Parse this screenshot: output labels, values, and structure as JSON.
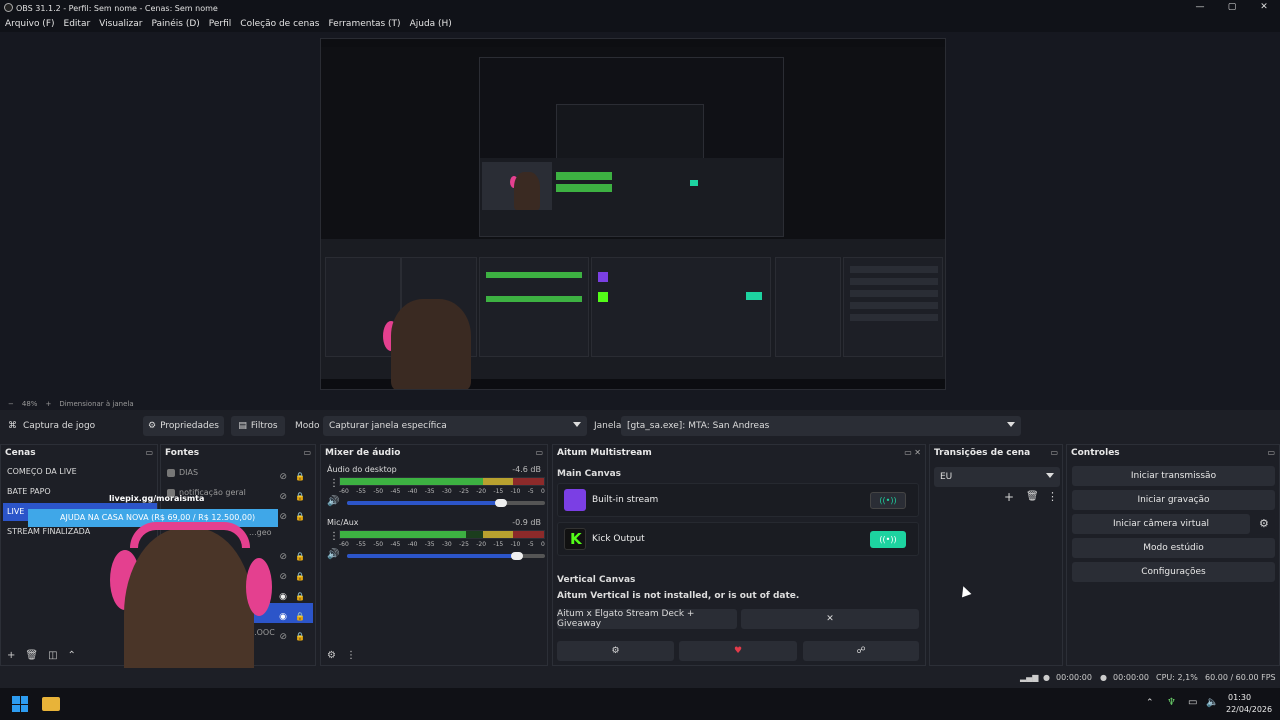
{
  "window": {
    "title": "OBS 31.1.2 - Perfil: Sem nome - Cenas: Sem nome",
    "controls": [
      "—",
      "▢",
      "✕"
    ]
  },
  "menu": [
    "Arquivo (F)",
    "Editar",
    "Visualizar",
    "Painéis (D)",
    "Perfil",
    "Coleção de cenas",
    "Ferramentas (T)",
    "Ajuda (H)"
  ],
  "preview": {
    "zoom": "48%",
    "resize_label": "Dimensionar à janela"
  },
  "source_toolbar": {
    "source_name": "Captura de jogo",
    "properties": "Propriedades",
    "filters": "Filtros",
    "mode_label": "Modo",
    "mode_value": "Capturar janela específica",
    "window_label": "Janela",
    "window_value": "[gta_sa.exe]: MTA: San Andreas"
  },
  "scenes": {
    "title": "Cenas",
    "items": [
      "COMEÇO DA LIVE",
      "BATE PAPO",
      "LIVE",
      "STREAM FINALIZADA"
    ],
    "selected": 2
  },
  "sources": {
    "title": "Fontes",
    "items": [
      {
        "name": "DIAS"
      },
      {
        "name": "notificação geral"
      },
      {
        "name": ""
      },
      {
        "name": "...geo"
      },
      {
        "name": ""
      },
      {
        "name": ""
      },
      {
        "name": ""
      },
      {
        "name": ""
      },
      {
        "name": "...OOC"
      }
    ]
  },
  "overlay": {
    "livepix": "livepix.gg/moraismta",
    "banner": "AJUDA NA CASA NOVA (R$ 69,00 / R$ 12.500,00)"
  },
  "mixer": {
    "title": "Mixer de áudio",
    "channels": [
      {
        "name": "Áudio do desktop",
        "db": "-4.6 dB",
        "level": 0.72,
        "volume": 0.78
      },
      {
        "name": "Mic/Aux",
        "db": "-0.9 dB",
        "level": 0.62,
        "volume": 0.86
      }
    ],
    "scale": [
      "-60",
      "-55",
      "-50",
      "-45",
      "-40",
      "-35",
      "-30",
      "-25",
      "-20",
      "-15",
      "-10",
      "-5",
      "0"
    ]
  },
  "multistream": {
    "title": "Aitum Multistream",
    "main_canvas": "Main Canvas",
    "outputs": [
      {
        "name": "Built-in stream",
        "logo_color": "#7b3fe4",
        "active": false
      },
      {
        "name": "Kick Output",
        "logo_color": "#53fc18",
        "active": true
      }
    ],
    "vertical_canvas": "Vertical Canvas",
    "vertical_warning": "Aitum Vertical is not installed, or is out of date.",
    "promo_button": "Aitum x Elgato Stream Deck + Giveaway",
    "close": "✕"
  },
  "transitions": {
    "title": "Transições de cena",
    "selected": "EU"
  },
  "controls": {
    "title": "Controles",
    "buttons": [
      "Iniciar transmissão",
      "Iniciar gravação",
      "Iniciar câmera virtual",
      "Modo estúdio",
      "Configurações"
    ]
  },
  "status": {
    "stream_time": "00:00:00",
    "rec_time": "00:00:00",
    "cpu": "CPU: 2,1%",
    "fps": "60.00 / 60.00 FPS"
  },
  "taskbar": {
    "time": "01:30",
    "date": "22/04/2026"
  },
  "colors": {
    "accent": "#2c55c9",
    "kick": "#53fc18",
    "toggle_active": "#1dd3a0",
    "headphone": "#e4408f",
    "banner": "#3fa7e8"
  }
}
